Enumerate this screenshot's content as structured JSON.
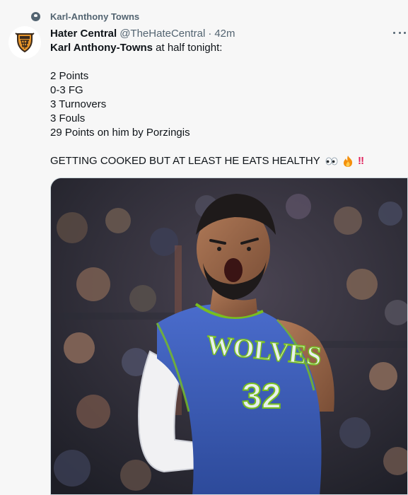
{
  "social_context": {
    "text": "Karl-Anthony Towns",
    "icon": "topic-icon"
  },
  "author": {
    "name": "Hater Central",
    "handle": "@TheHateCentral",
    "separator": "·",
    "time": "42m",
    "avatar_icon": "hater-central-logo"
  },
  "more_icon": "more-options-icon",
  "tweet": {
    "lead_bold": "Karl Anthony-Towns",
    "lead_rest": " at half tonight:",
    "stats": [
      "2 Points",
      "0-3 FG",
      "3 Turnovers",
      "3 Fouls",
      "29 Points on him by Porzingis"
    ],
    "closing": "GETTING COOKED BUT AT LEAST HE EATS HEALTHY",
    "emojis": [
      "eyes-emoji",
      "fire-emoji",
      "double-exclamation-emoji"
    ],
    "bang": "‼"
  },
  "media": {
    "jersey_team": "WOLVES",
    "jersey_number": "32",
    "jersey_color": "#3e5fb3",
    "trim_color": "#78be20"
  }
}
